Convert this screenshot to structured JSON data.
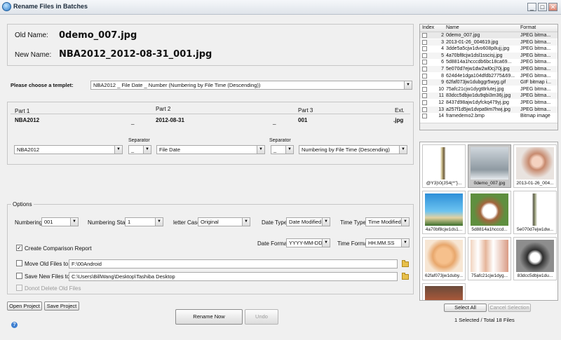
{
  "window": {
    "title": "Rename Files in Batches",
    "min_label": "_",
    "max_label": "□",
    "close_label": "✕"
  },
  "preview": {
    "old_label": "Old Name:",
    "old_value": "0demo_007.jpg",
    "new_label": "New Name:",
    "new_value": "NBA2012_2012-08-31_001.jpg"
  },
  "template": {
    "label": "Please choose a templet:",
    "selected": "NBA2012 _ File Date _ Number (Numbering by File Time (Descending))"
  },
  "parts": {
    "headers": {
      "part1": "Part 1",
      "part2": "Part 2",
      "part3": "Part 3",
      "ext": "Ext."
    },
    "values": {
      "part1": "NBA2012",
      "sep1": "_",
      "part2": "2012-08-31",
      "sep2": "_",
      "part3": "001",
      "ext": ".jpg"
    },
    "separator_label": "Separator",
    "combo1": "NBA2012",
    "combo_sep1": "_",
    "combo2": "File Date",
    "combo_sep2": "_",
    "combo3": "Numbering by File Time (Descending)"
  },
  "options": {
    "legend": "Options",
    "numbering_label": "Numbering",
    "numbering_value": "001",
    "numbering_start_label": "Numbering Start",
    "numbering_start_value": "1",
    "letter_case_label": "letter Case",
    "letter_case_value": "Original",
    "date_type_label": "Date Type",
    "date_type_value": "Date Modified",
    "time_type_label": "Time Type",
    "time_type_value": "Time Modified",
    "date_format_label": "Date Format",
    "date_format_value": "YYYY-MM-DD",
    "time_format_label": "Time Format",
    "time_format_value": "HH.MM.SS",
    "create_report_label": "Create Comparison Report",
    "move_old_label": "Move Old Files to",
    "move_old_path": "F:\\00Android",
    "save_new_label": "Save New Files to",
    "save_new_path": "C:\\Users\\BillWang\\Desktop\\Tashiba Desktop",
    "dont_delete_label": "Donot Delete Old Files"
  },
  "buttons": {
    "open_project": "Open Project",
    "save_project": "Save Project",
    "rename_now": "Rename Now",
    "undo": "Undo",
    "select_all": "Select All",
    "cancel_selection": "Cancel Selection"
  },
  "file_list": {
    "headers": {
      "index": "Index",
      "name": "Name",
      "format": "Format"
    },
    "rows": [
      {
        "index": "2",
        "name": "0demo_007.jpg",
        "format": "JPEG bitma..."
      },
      {
        "index": "3",
        "name": "2013-01-26_004619.jpg",
        "format": "JPEG bitma..."
      },
      {
        "index": "4",
        "name": "3dde5a5cjw1dvo608p8ujj.jpg",
        "format": "JPEG bitma..."
      },
      {
        "index": "5",
        "name": "4a70bf8cjw1dsl1sscisj.jpg",
        "format": "JPEG bitma..."
      },
      {
        "index": "6",
        "name": "5d8814a1hcccdb6bc18ca69...",
        "format": "JPEG bitma..."
      },
      {
        "index": "7",
        "name": "5e070d7ejw1dw2wl0cj70j.jpg",
        "format": "JPEG bitma..."
      },
      {
        "index": "8",
        "name": "624d4e1dga104dfdb2775&69...",
        "format": "JPEG bitma..."
      },
      {
        "index": "9",
        "name": "62faf073jw1dubggr5wyg.gif",
        "format": "GIF bitmap i..."
      },
      {
        "index": "10",
        "name": "75afc21cjw1dygt8rlutej.jpg",
        "format": "JPEG bitma..."
      },
      {
        "index": "11",
        "name": "83dcc5dbjw1du9qbi3m36j.jpg",
        "format": "JPEG bitma..."
      },
      {
        "index": "12",
        "name": "8437d98ajw1dyfckq479yj.jpg",
        "format": "JPEG bitma..."
      },
      {
        "index": "13",
        "name": "a257f1d5jw1dvpa9im7hwj.jpg",
        "format": "JPEG bitma..."
      },
      {
        "index": "14",
        "name": "framedemo2.bmp",
        "format": "Bitmap image"
      }
    ]
  },
  "gallery": {
    "items": [
      {
        "caption": "@Y3)\\0(JS4(^\"}..."
      },
      {
        "caption": "0demo_007.jpg"
      },
      {
        "caption": "2013-01-26_004..."
      },
      {
        "caption": "4a70bf8cjw1ds1..."
      },
      {
        "caption": "5d8814a1hcccd..."
      },
      {
        "caption": "5e070d7ejw1dw..."
      },
      {
        "caption": "62faf073jw1duby..."
      },
      {
        "caption": "75afc21cjw1dyg..."
      },
      {
        "caption": "83dcc5dbjw1du..."
      },
      {
        "caption": ""
      }
    ]
  },
  "status": {
    "selection": "1 Selected / Total 18 Files"
  }
}
